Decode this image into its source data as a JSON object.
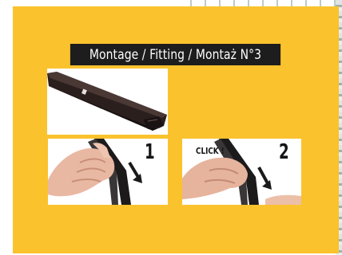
{
  "heading": "Montage / Fitting / Montaż N°3",
  "steps": [
    {
      "number": "1"
    },
    {
      "number": "2",
      "callout": "CLICK !"
    }
  ],
  "colors": {
    "panel": "#fac22d",
    "heading_bg": "#1e1d1e",
    "heading_text": "#ffffff"
  }
}
